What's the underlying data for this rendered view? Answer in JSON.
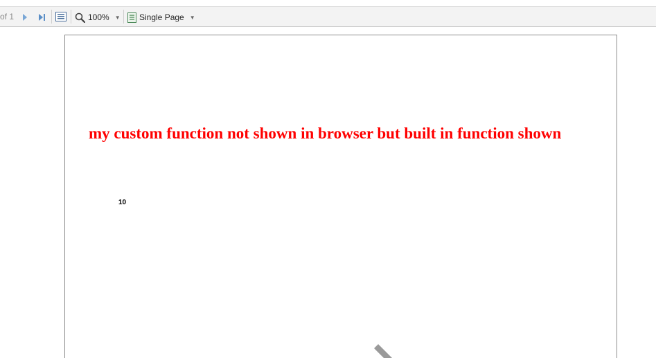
{
  "toolbar": {
    "page_of_text": "of 1",
    "zoom_level": "100%",
    "page_layout": "Single Page",
    "icons": {
      "next": "next-page-icon",
      "last": "last-page-icon",
      "fit": "fit-page-icon",
      "zoom": "zoom-icon",
      "layout": "single-page-icon"
    }
  },
  "document": {
    "heading": "my custom function not shown in browser but built in function shown",
    "value": "10"
  },
  "colors": {
    "heading": "#ff0000",
    "toolbar_bg": "#f3f3f3",
    "icon_blue": "#5b8fc7"
  }
}
